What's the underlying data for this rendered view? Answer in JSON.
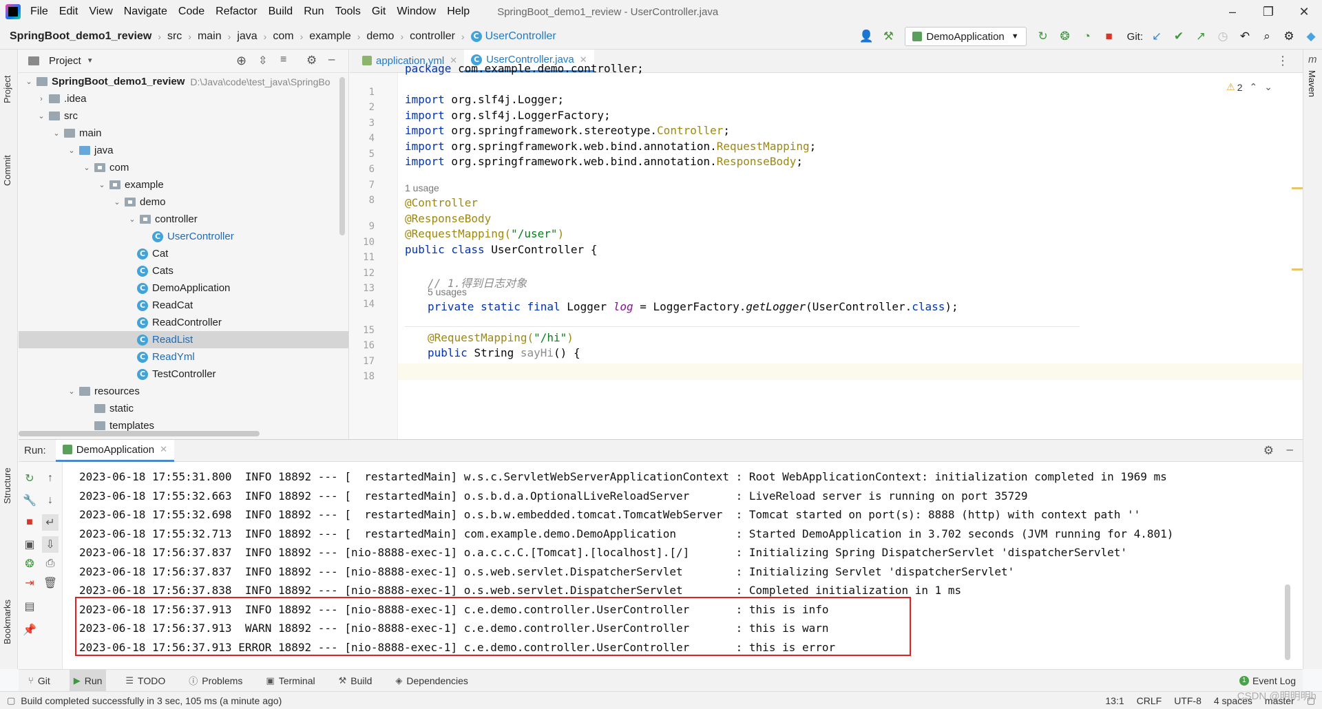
{
  "menubar": {
    "items": [
      "File",
      "Edit",
      "View",
      "Navigate",
      "Code",
      "Refactor",
      "Build",
      "Run",
      "Tools",
      "Git",
      "Window",
      "Help"
    ],
    "window_title": "SpringBoot_demo1_review - UserController.java"
  },
  "breadcrumb": [
    "SpringBoot_demo1_review",
    "src",
    "main",
    "java",
    "com",
    "example",
    "demo",
    "controller"
  ],
  "breadcrumb_class": "UserController",
  "toolbar": {
    "run_config": "DemoApplication",
    "git_label": "Git:"
  },
  "left_stripe": {
    "project": "Project",
    "commit": "Commit",
    "structure": "Structure",
    "bookmarks": "Bookmarks"
  },
  "right_stripe": {
    "maven": "Maven"
  },
  "project": {
    "title": "Project",
    "root": "SpringBoot_demo1_review",
    "root_path": "D:\\Java\\code\\test_java\\SpringBo",
    "nodes": [
      ".idea",
      "src",
      "main",
      "java",
      "com",
      "example",
      "demo",
      "controller",
      "UserController",
      "Cat",
      "Cats",
      "DemoApplication",
      "ReadCat",
      "ReadController",
      "ReadList",
      "ReadYml",
      "TestController",
      "resources",
      "static",
      "templates"
    ]
  },
  "editor": {
    "tabs": [
      "application.yml",
      "UserController.java"
    ],
    "warnings": "2",
    "line_numbers": [
      "1",
      "2",
      "3",
      "4",
      "5",
      "6",
      "7",
      "8",
      "9",
      "10",
      "11",
      "12",
      "13",
      "14",
      "15",
      "16",
      "17",
      "18"
    ],
    "code": {
      "l1_kw": "package",
      "l1_rest": " com.example.demo.controller;",
      "import_kw": "import",
      "l3": " org.slf4j.Logger;",
      "l4": " org.slf4j.LoggerFactory;",
      "l5_a": " org.springframework.stereotype.",
      "l5_b": "Controller",
      "l6_a": " org.springframework.web.bind.annotation.",
      "l6_b": "RequestMapping",
      "l7_a": " org.springframework.web.bind.annotation.",
      "l7_b": "ResponseBody",
      "semi": ";",
      "hint_1usage": "1 usage",
      "l9": "@Controller",
      "l10": "@ResponseBody",
      "l11_a": "@RequestMapping(",
      "l11_b": "\"/user\"",
      "l11_c": ")",
      "l12_a": "public class ",
      "l12_b": "UserController",
      "l12_c": " {",
      "l14": "// 1.得到日志对象",
      "hint_5usages": "5 usages",
      "l15_a": "private static final ",
      "l15_b": "Logger ",
      "l15_c": "log",
      "l15_d": " = LoggerFactory.",
      "l15_e": "getLogger",
      "l15_f": "(UserController.",
      "l15_g": "class",
      "l15_h": ");",
      "l17_a": "@RequestMapping(",
      "l17_b": "\"/hi\"",
      "l17_c": ")",
      "l18_a": "public ",
      "l18_b": "String ",
      "l18_c": "sayHi",
      "l18_d": "() {"
    }
  },
  "run": {
    "label": "Run:",
    "tab": "DemoApplication",
    "log": [
      "2023-06-18 17:55:31.800  INFO 18892 --- [  restartedMain] w.s.c.ServletWebServerApplicationContext : Root WebApplicationContext: initialization completed in 1969 ms",
      "2023-06-18 17:55:32.663  INFO 18892 --- [  restartedMain] o.s.b.d.a.OptionalLiveReloadServer       : LiveReload server is running on port 35729",
      "2023-06-18 17:55:32.698  INFO 18892 --- [  restartedMain] o.s.b.w.embedded.tomcat.TomcatWebServer  : Tomcat started on port(s): 8888 (http) with context path ''",
      "2023-06-18 17:55:32.713  INFO 18892 --- [  restartedMain] com.example.demo.DemoApplication         : Started DemoApplication in 3.702 seconds (JVM running for 4.801)",
      "2023-06-18 17:56:37.837  INFO 18892 --- [nio-8888-exec-1] o.a.c.c.C.[Tomcat].[localhost].[/]       : Initializing Spring DispatcherServlet 'dispatcherServlet'",
      "2023-06-18 17:56:37.837  INFO 18892 --- [nio-8888-exec-1] o.s.web.servlet.DispatcherServlet        : Initializing Servlet 'dispatcherServlet'",
      "2023-06-18 17:56:37.838  INFO 18892 --- [nio-8888-exec-1] o.s.web.servlet.DispatcherServlet        : Completed initialization in 1 ms",
      "2023-06-18 17:56:37.913  INFO 18892 --- [nio-8888-exec-1] c.e.demo.controller.UserController       : this is info",
      "2023-06-18 17:56:37.913  WARN 18892 --- [nio-8888-exec-1] c.e.demo.controller.UserController       : this is warn",
      "2023-06-18 17:56:37.913 ERROR 18892 --- [nio-8888-exec-1] c.e.demo.controller.UserController       : this is error"
    ]
  },
  "tool_windows": [
    "Git",
    "Run",
    "TODO",
    "Problems",
    "Terminal",
    "Build",
    "Dependencies"
  ],
  "event_log": "Event Log",
  "status": {
    "message": "Build completed successfully in 3 sec, 105 ms (a minute ago)",
    "position": "13:1",
    "line_sep": "CRLF",
    "encoding": "UTF-8",
    "indent": "4 spaces",
    "branch": "master"
  },
  "watermark": "CSDN @明明明h"
}
